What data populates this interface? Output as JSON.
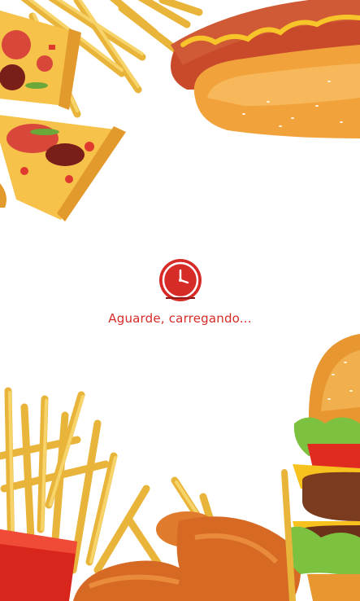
{
  "loading": {
    "message": "Aguarde, carregando..."
  },
  "icons": {
    "loading": "clock-icon"
  },
  "colors": {
    "accent": "#d62b27",
    "background": "#ffffff"
  }
}
